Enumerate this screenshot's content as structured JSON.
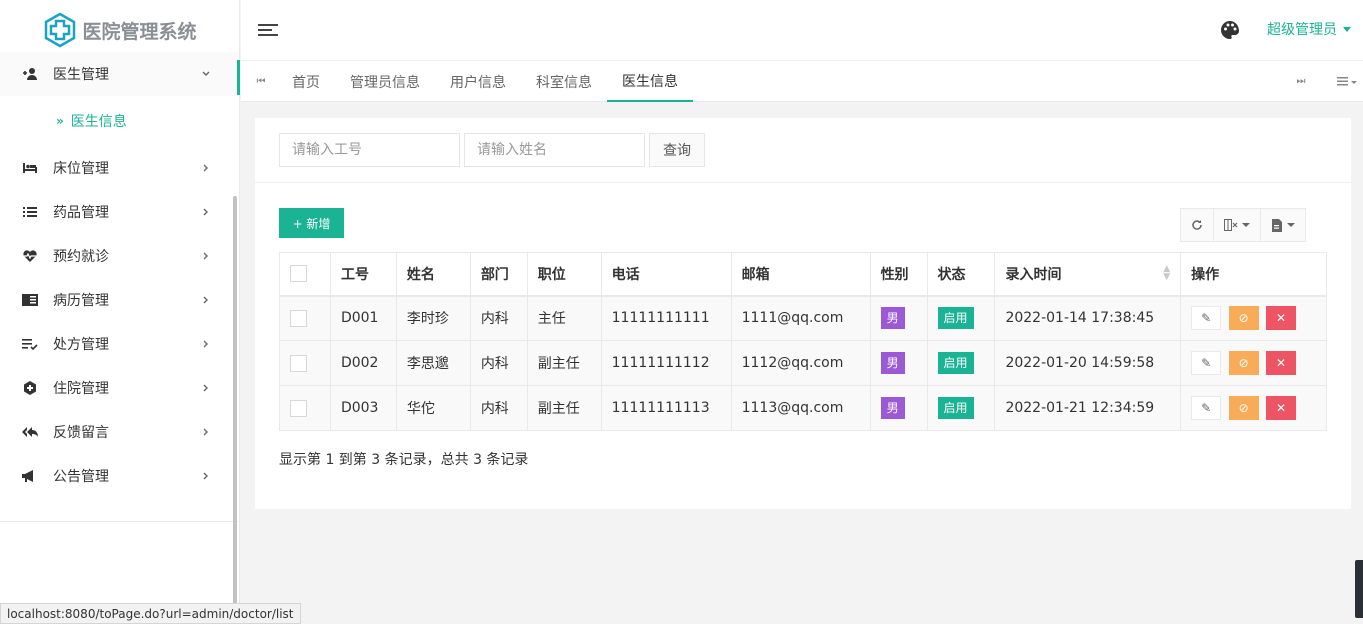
{
  "app": {
    "title": "医院管理系统"
  },
  "sidebar": {
    "items": [
      {
        "label": "医生管理",
        "icon": "user-plus-icon",
        "expanded": true
      },
      {
        "label": "床位管理",
        "icon": "bed-icon"
      },
      {
        "label": "药品管理",
        "icon": "list-icon"
      },
      {
        "label": "预约就诊",
        "icon": "heartbeat-icon"
      },
      {
        "label": "病历管理",
        "icon": "book-icon"
      },
      {
        "label": "处方管理",
        "icon": "prescription-icon"
      },
      {
        "label": "住院管理",
        "icon": "hospital-icon"
      },
      {
        "label": "反馈留言",
        "icon": "reply-all-icon"
      },
      {
        "label": "公告管理",
        "icon": "bullhorn-icon"
      }
    ],
    "submenu": {
      "label": "医生信息"
    }
  },
  "header": {
    "user": "超级管理员"
  },
  "tabs": [
    {
      "label": "首页"
    },
    {
      "label": "管理员信息"
    },
    {
      "label": "用户信息"
    },
    {
      "label": "科室信息"
    },
    {
      "label": "医生信息",
      "active": true
    }
  ],
  "search": {
    "id_placeholder": "请输入工号",
    "name_placeholder": "请输入姓名",
    "query_label": "查询"
  },
  "toolbar": {
    "add_label": "+ 新增"
  },
  "table": {
    "headers": [
      "工号",
      "姓名",
      "部门",
      "职位",
      "电话",
      "邮箱",
      "性别",
      "状态",
      "录入时间",
      "操作"
    ],
    "rows": [
      {
        "id": "D001",
        "name": "李时珍",
        "dept": "内科",
        "title": "主任",
        "phone": "11111111111",
        "email": "1111@qq.com",
        "gender": "男",
        "status": "启用",
        "time": "2022-01-14 17:38:45"
      },
      {
        "id": "D002",
        "name": "李思邈",
        "dept": "内科",
        "title": "副主任",
        "phone": "11111111112",
        "email": "1112@qq.com",
        "gender": "男",
        "status": "启用",
        "time": "2022-01-20 14:59:58"
      },
      {
        "id": "D003",
        "name": "华佗",
        "dept": "内科",
        "title": "副主任",
        "phone": "11111111113",
        "email": "1113@qq.com",
        "gender": "男",
        "status": "启用",
        "time": "2022-01-21 12:34:59"
      }
    ]
  },
  "pagination": {
    "summary": "显示第 1 到第 3 条记录，总共 3 条记录"
  },
  "statusbar": {
    "url": "localhost:8080/toPage.do?url=admin/doctor/list"
  },
  "colors": {
    "accent": "#1ab394",
    "male_tag": "#9b59d6",
    "warning": "#f8ac59",
    "danger": "#ed5565"
  }
}
